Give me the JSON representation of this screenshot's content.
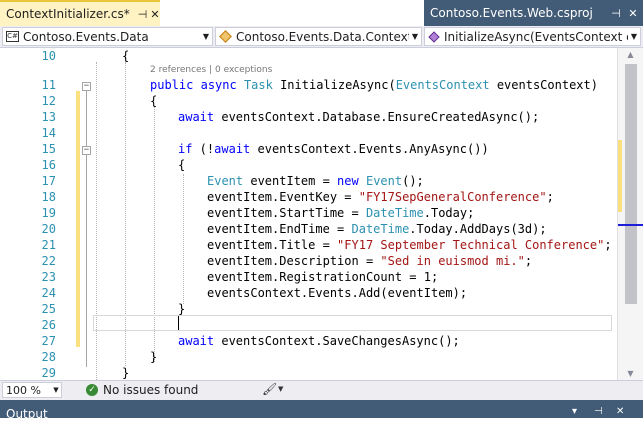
{
  "tabs": {
    "active": {
      "title": "ContextInitializer.cs*",
      "pin": "⊣",
      "close": "✕"
    },
    "other": {
      "title": "Contoso.Events.Web.csproj",
      "pin": "⊣",
      "close": "✕"
    }
  },
  "navbar": {
    "project": "Contoso.Events.Data",
    "type": "Contoso.Events.Data.ContextIniti",
    "member": "InitializeAsync(EventsContext eve"
  },
  "editor": {
    "code_lens": "2 references | 0 exceptions",
    "line_numbers": [
      "10",
      "11",
      "12",
      "13",
      "14",
      "15",
      "16",
      "17",
      "18",
      "19",
      "20",
      "21",
      "22",
      "23",
      "24",
      "25",
      "26",
      "27",
      "28",
      "29"
    ],
    "lines": {
      "l10": {
        "brace": "{"
      },
      "l11": {
        "kw1": "public",
        "kw2": "async",
        "type": "Task",
        "rest": " InitializeAsync(",
        "ptype": "EventsContext",
        "pname": " eventsContext)"
      },
      "l12": {
        "brace": "{"
      },
      "l13": {
        "kw": "await",
        "rest": " eventsContext.Database.EnsureCreatedAsync();"
      },
      "l15": {
        "kw": "if",
        "p1": " (!",
        "kw2": "await",
        "rest": " eventsContext.Events.AnyAsync())"
      },
      "l16": {
        "brace": "{"
      },
      "l17": {
        "type": "Event",
        "var": " eventItem = ",
        "kw": "new",
        "type2": "Event",
        "end": "();"
      },
      "l18": {
        "pre": "eventItem.EventKey = ",
        "str": "\"FY17SepGeneralConference\"",
        "end": ";"
      },
      "l19": {
        "pre": "eventItem.StartTime = ",
        "type": "DateTime",
        "end": ".Today;"
      },
      "l20": {
        "pre": "eventItem.EndTime = ",
        "type": "DateTime",
        "end": ".Today.AddDays(3d);"
      },
      "l21": {
        "pre": "eventItem.Title = ",
        "str": "\"FY17 September Technical Conference\"",
        "end": ";"
      },
      "l22": {
        "pre": "eventItem.Description = ",
        "str": "\"Sed in euismod mi.\"",
        "end": ";"
      },
      "l23": {
        "text": "eventItem.RegistrationCount = 1;"
      },
      "l24": {
        "text": "eventsContext.Events.Add(eventItem);"
      },
      "l25": {
        "brace": "}"
      },
      "l27": {
        "kw": "await",
        "rest": " eventsContext.SaveChangesAsync();"
      },
      "l28": {
        "brace": "}"
      },
      "l29": {
        "brace": "}"
      }
    }
  },
  "statusbar": {
    "zoom": "100 %",
    "issues": "No issues found",
    "check_glyph": "✓",
    "brush_glyph": "🖌"
  },
  "output": {
    "title": "Output",
    "pin": "⊣",
    "close": "✕",
    "dropdown": "▾"
  },
  "colors": {
    "keyword": "#0000ff",
    "type": "#2b91af",
    "string": "#a31515",
    "active_tab": "#fff3c4",
    "tool_window_header": "#425b76",
    "change_margin": "#fae17d"
  },
  "icons": {
    "project_icon": "C#",
    "dropdown_arrow": "▼",
    "scroll_up": "▲",
    "scroll_down": "▼",
    "fold_minus": "−"
  }
}
